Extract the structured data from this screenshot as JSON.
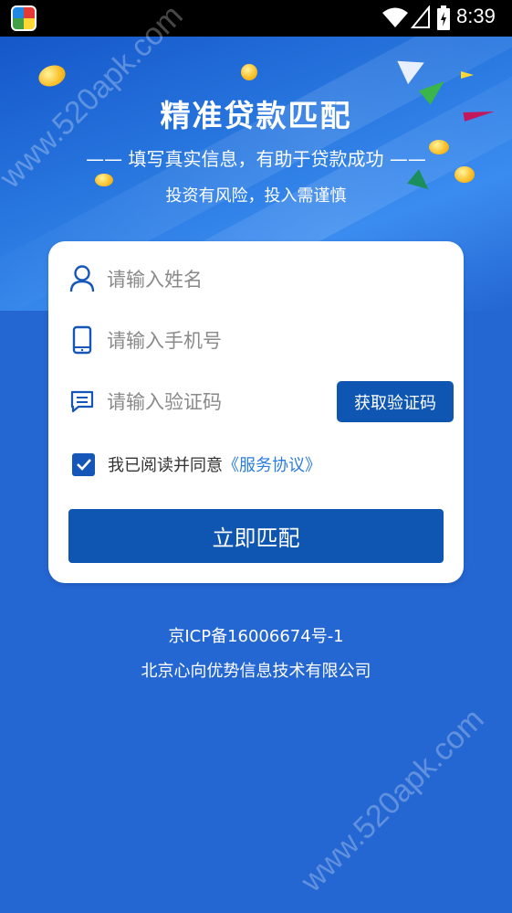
{
  "status_bar": {
    "time": "8:39"
  },
  "hero": {
    "title": "精准贷款匹配",
    "subtitle": "—— 填写真实信息，有助于贷款成功 ——",
    "risk_note": "投资有风险，投入需谨慎"
  },
  "form": {
    "name_placeholder": "请输入姓名",
    "phone_placeholder": "请输入手机号",
    "code_placeholder": "请输入验证码",
    "get_code_label": "获取验证码",
    "agree_text": "我已阅读并同意",
    "agreement_link": "《服务协议》",
    "agree_checked": true,
    "submit_label": "立即匹配"
  },
  "footer": {
    "icp": "京ICP备16006674号-1",
    "company": "北京心向优势信息技术有限公司"
  },
  "watermark": "www.520apk.com",
  "colors": {
    "background": "#2466d2",
    "primary_button": "#0f56b3",
    "link": "#2b7de0"
  }
}
